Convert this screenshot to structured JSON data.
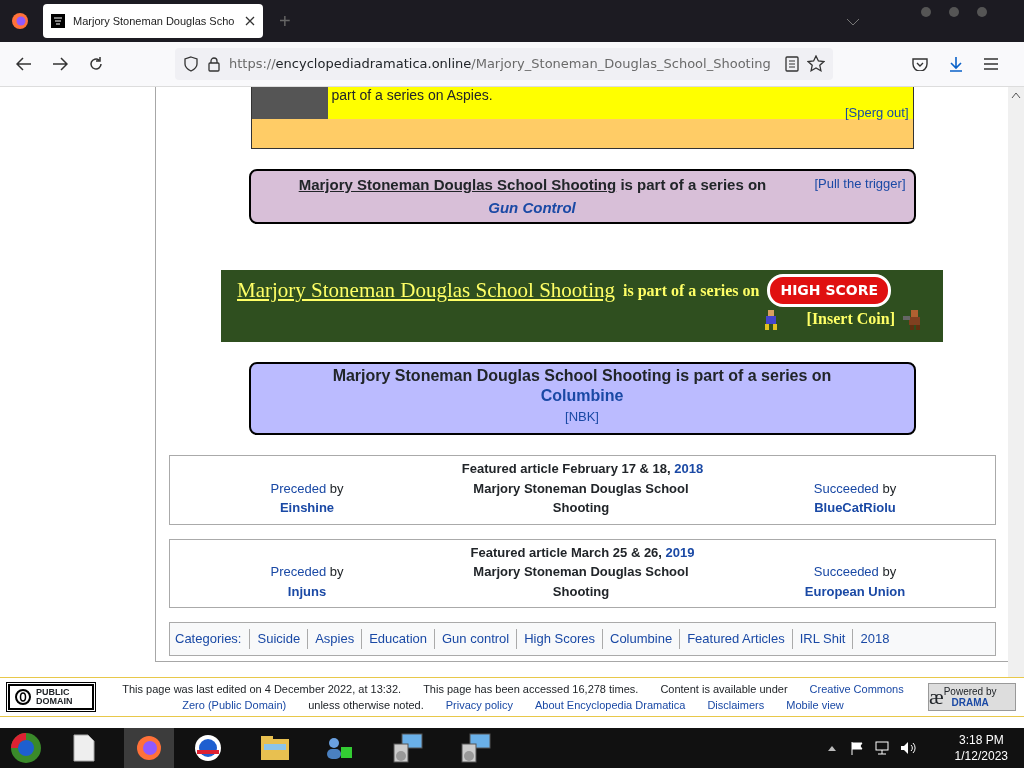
{
  "browser": {
    "tab_title": "Marjory Stoneman Douglas Scho",
    "new_tab": "+",
    "url": {
      "scheme": "https://",
      "host": "encyclopediadramatica.online",
      "path": "/Marjory_Stoneman_Douglas_School_Shooting"
    }
  },
  "aspies_box": {
    "text": "part of a series on Aspies.",
    "link": "[Sperg out]"
  },
  "gun_control_box": {
    "title": "Marjory Stoneman Douglas School Shooting",
    "middle": "is part of a series on",
    "series": "Gun Control",
    "link": "[Pull the trigger]"
  },
  "high_score_banner": {
    "title": "Marjory Stoneman Douglas School Shooting",
    "middle": "is part of a series on",
    "logo": "HIGH SCORE",
    "link": "[Insert Coin]"
  },
  "columbine_box": {
    "title": "Marjory Stoneman Douglas School Shooting",
    "middle": "is part of a series on",
    "series": "Columbine",
    "link": "[NBK]"
  },
  "featured": [
    {
      "heading": "Featured article February 17 & 18,",
      "year": "2018",
      "prev_label": "Preceded",
      "prev_by": "by",
      "prev": "Einshine",
      "title": "Marjory Stoneman Douglas School Shooting",
      "next_label": "Succeeded",
      "next_by": "by",
      "next": "BlueCatRiolu"
    },
    {
      "heading": "Featured article March 25 & 26,",
      "year": "2019",
      "prev_label": "Preceded",
      "prev_by": "by",
      "prev": "Injuns",
      "title": "Marjory Stoneman Douglas School Shooting",
      "next_label": "Succeeded",
      "next_by": "by",
      "next": "European Union"
    }
  ],
  "categories": {
    "label": "Categories:",
    "items": [
      "Suicide",
      "Aspies",
      "Education",
      "Gun control",
      "High Scores",
      "Columbine",
      "Featured Articles",
      "IRL Shit",
      "2018"
    ]
  },
  "footer": {
    "license_badge": "PUBLIC DOMAIN",
    "items": [
      {
        "kind": "text",
        "text": "This page was last edited on 4 December 2022, at 13:32."
      },
      {
        "kind": "text",
        "text": "This page has been accessed 16,278 times."
      },
      {
        "kind": "text",
        "text": "Content is available under"
      },
      {
        "kind": "link",
        "text": "Creative Commons"
      },
      {
        "kind": "link",
        "text": "Zero (Public Domain)"
      },
      {
        "kind": "text",
        "text": "unless otherwise noted."
      },
      {
        "kind": "link",
        "text": "Privacy policy"
      },
      {
        "kind": "link",
        "text": "About Encyclopedia Dramatica"
      },
      {
        "kind": "link",
        "text": "Disclaimers"
      },
      {
        "kind": "link",
        "text": "Mobile view"
      }
    ],
    "powered_logo": "æ",
    "powered_by": "Powered by",
    "powered_name": "DRAMA"
  },
  "taskbar": {
    "time": "3:18 PM",
    "date": "1/12/2023"
  }
}
